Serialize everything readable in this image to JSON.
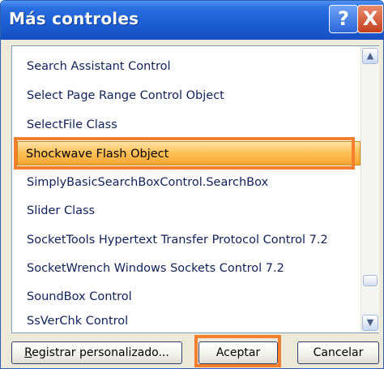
{
  "window": {
    "title": "Más controles"
  },
  "titlebar": {
    "help_label": "?",
    "close_label": "X"
  },
  "list": {
    "items": [
      "Search Assistant Control",
      "Select Page Range Control Object",
      "SelectFile Class",
      "Shockwave Flash Object",
      "SimplyBasicSearchBoxControl.SearchBox",
      "Slider Class",
      "SocketTools Hypertext Transfer Protocol Control 7.2",
      "SocketWrench Windows Sockets Control 7.2",
      "SoundBox Control",
      "SsVerChk Control"
    ],
    "selected_item": "Shockwave Flash Object"
  },
  "scrollbar": {
    "up_icon": "▲",
    "down_icon": "▼"
  },
  "buttons": {
    "register_label": "Registrar personalizado...",
    "register_mnemonic": "R",
    "register_rest": "egistrar personalizado...",
    "ok_label": "Aceptar",
    "cancel_label": "Cancelar"
  },
  "colors": {
    "highlight": "#f57f2d",
    "title_bar": "#1c5fd6",
    "selection": "#ffc25a"
  }
}
